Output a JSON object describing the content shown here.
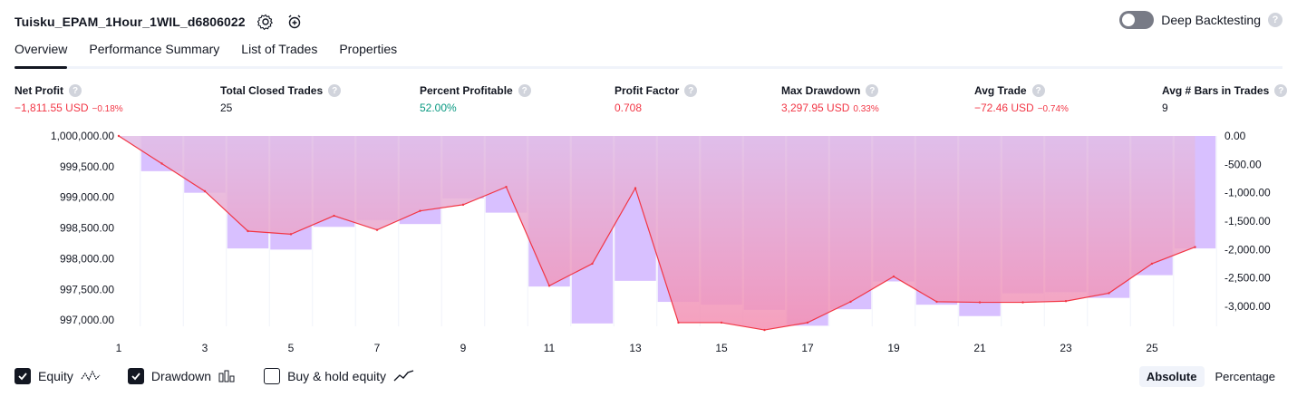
{
  "header": {
    "strategy_title": "Tuisku_EPAM_1Hour_1WIL_d6806022",
    "deep_backtesting_label": "Deep Backtesting",
    "deep_backtesting_enabled": false
  },
  "tabs": [
    {
      "label": "Overview",
      "active": true
    },
    {
      "label": "Performance Summary",
      "active": false
    },
    {
      "label": "List of Trades",
      "active": false
    },
    {
      "label": "Properties",
      "active": false
    }
  ],
  "metrics": [
    {
      "label": "Net Profit",
      "value": "−1,811.55 USD",
      "pct": "−0.18%",
      "tone": "neg"
    },
    {
      "label": "Total Closed Trades",
      "value": "25",
      "pct": "",
      "tone": ""
    },
    {
      "label": "Percent Profitable",
      "value": "52.00%",
      "pct": "",
      "tone": "pos"
    },
    {
      "label": "Profit Factor",
      "value": "0.708",
      "pct": "",
      "tone": "neg"
    },
    {
      "label": "Max Drawdown",
      "value": "3,297.95 USD",
      "pct": "0.33%",
      "tone": "neg"
    },
    {
      "label": "Avg Trade",
      "value": "−72.46 USD",
      "pct": "−0.74%",
      "tone": "neg"
    },
    {
      "label": "Avg # Bars in Trades",
      "value": "9",
      "pct": "",
      "tone": ""
    }
  ],
  "colors": {
    "equity_line": "#f23645",
    "drawdown_bar": "#ceb0ff",
    "equity_fill_top": "#e1bee7",
    "equity_fill_bottom": "#f48fb1",
    "negative": "#f23645",
    "positive": "#089981"
  },
  "chart_data": {
    "type": "line",
    "x": [
      1,
      2,
      3,
      4,
      5,
      6,
      7,
      8,
      9,
      10,
      11,
      12,
      13,
      14,
      15,
      16,
      17,
      18,
      19,
      20,
      21,
      22,
      23,
      24,
      25,
      26
    ],
    "x_tick_labels": [
      "1",
      "3",
      "5",
      "7",
      "9",
      "11",
      "13",
      "15",
      "17",
      "19",
      "21",
      "23",
      "25"
    ],
    "series": [
      {
        "name": "Equity",
        "axis": "left",
        "values": [
          1000000,
          999550,
          999100,
          998450,
          998400,
          998700,
          998470,
          998780,
          998880,
          999170,
          997560,
          997920,
          999150,
          996960,
          996960,
          996840,
          996960,
          997300,
          997710,
          997300,
          997290,
          997290,
          997310,
          997440,
          997920,
          998190
        ]
      },
      {
        "name": "Drawdown",
        "axis": "right",
        "type": "bar",
        "values": [
          0,
          -620,
          -1000,
          -1980,
          -2000,
          -1600,
          -1480,
          -1550,
          -1100,
          -1350,
          -2650,
          -3300,
          -2550,
          -2920,
          -2970,
          -3060,
          -3340,
          -3050,
          -2560,
          -2970,
          -3170,
          -2770,
          -2750,
          -2850,
          -2450,
          -1980
        ]
      }
    ],
    "left_axis": {
      "ticks": [
        "1,000,000.00",
        "999,500.00",
        "999,000.00",
        "998,500.00",
        "998,000.00",
        "997,500.00",
        "997,000.00"
      ],
      "ylim": [
        996900,
        1000000
      ]
    },
    "right_axis": {
      "ticks": [
        "0.00",
        "-500.00",
        "-1,000.00",
        "-1,500.00",
        "-2,000.00",
        "-2,500.00",
        "-3,000.00"
      ],
      "ylim": [
        -3350,
        0
      ]
    },
    "grid": true
  },
  "footer": {
    "legend": [
      {
        "label": "Equity",
        "checked": true,
        "icon": "equity-icon"
      },
      {
        "label": "Drawdown",
        "checked": true,
        "icon": "drawdown-icon"
      },
      {
        "label": "Buy & hold equity",
        "checked": false,
        "icon": "buy-hold-icon"
      }
    ],
    "scale_options": [
      {
        "label": "Absolute",
        "active": true
      },
      {
        "label": "Percentage",
        "active": false
      }
    ]
  }
}
